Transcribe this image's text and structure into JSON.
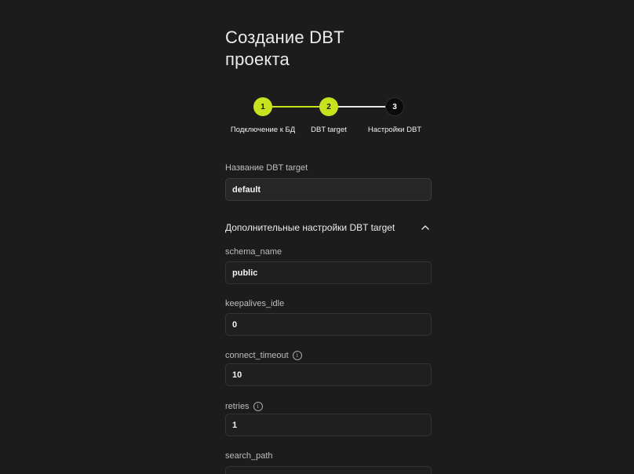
{
  "page": {
    "title": "Создание DBT проекта"
  },
  "stepper": {
    "steps": [
      {
        "number": "1",
        "label": "Подключение к БД",
        "state": "done"
      },
      {
        "number": "2",
        "label": "DBT target",
        "state": "active"
      },
      {
        "number": "3",
        "label": "Настройки DBT",
        "state": "pending"
      }
    ]
  },
  "target_name": {
    "label": "Название DBT target",
    "value": "default"
  },
  "advanced": {
    "title": "Дополнительные настройки DBT target",
    "expanded": true,
    "toggle_icon": "chevron-up-icon",
    "fields": {
      "schema_name": {
        "label": "schema_name",
        "value": "public"
      },
      "keepalives_idle": {
        "label": "keepalives_idle",
        "value": "0"
      },
      "connect_timeout": {
        "label": "connect_timeout",
        "value": "10",
        "info_icon": "info-icon"
      },
      "retries": {
        "label": "retries",
        "value": "1",
        "info_icon": "info-icon"
      },
      "search_path": {
        "label": "search_path",
        "value": ""
      }
    }
  },
  "colors": {
    "background": "#1c1c1c",
    "accent": "#c6e31e",
    "input_border": "#333333",
    "pending_step": "#0b0b0b"
  }
}
